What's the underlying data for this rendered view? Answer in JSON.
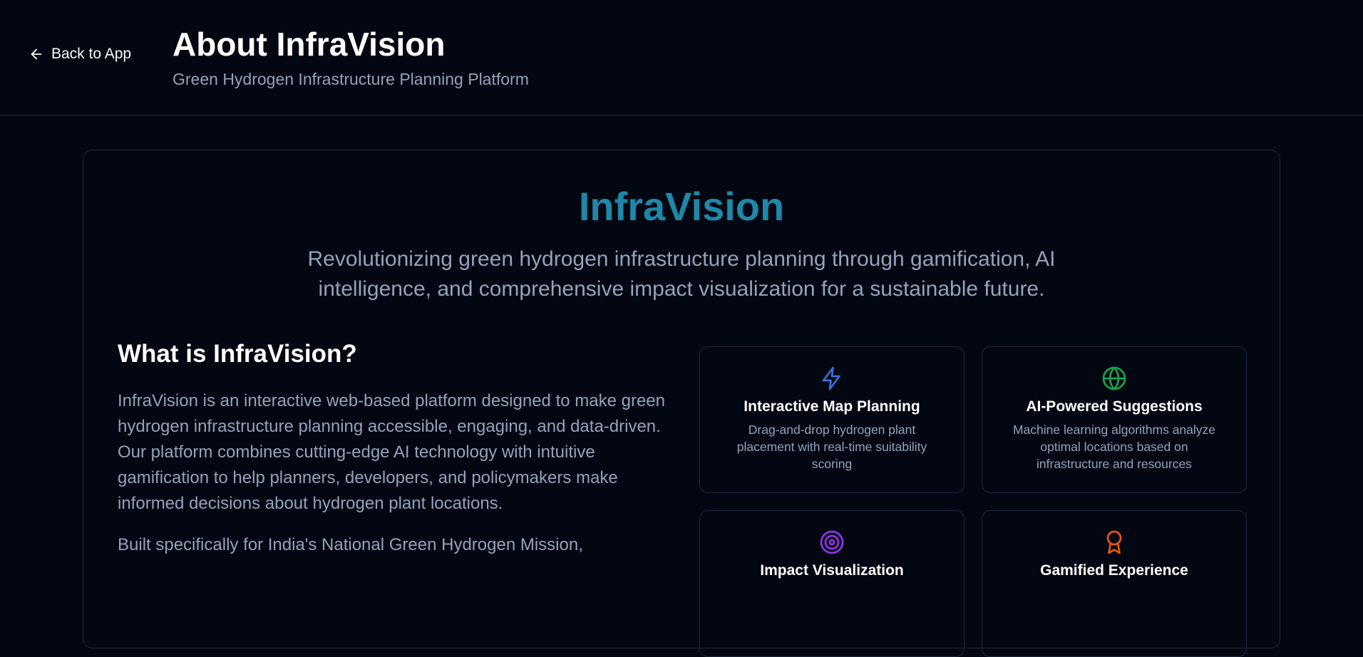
{
  "header": {
    "back_label": "Back to App",
    "title": "About InfraVision",
    "subtitle": "Green Hydrogen Infrastructure Planning Platform"
  },
  "hero": {
    "title": "InfraVision",
    "description": "Revolutionizing green hydrogen infrastructure planning through gamification, AI intelligence, and comprehensive impact visualization for a sustainable future."
  },
  "about": {
    "heading": "What is InfraVision?",
    "paragraphs": [
      "InfraVision is an interactive web-based platform designed to make green hydrogen infrastructure planning accessible, engaging, and data-driven. Our platform combines cutting-edge AI technology with intuitive gamification to help planners, developers, and policymakers make informed decisions about hydrogen plant locations.",
      "Built specifically for India's National Green Hydrogen Mission,"
    ]
  },
  "features": [
    {
      "icon": "zap-icon",
      "color": "#3b6fd9",
      "title": "Interactive Map Planning",
      "description": "Drag-and-drop hydrogen plant placement with real-time suitability scoring"
    },
    {
      "icon": "globe-icon",
      "color": "#16a34a",
      "title": "AI-Powered Suggestions",
      "description": "Machine learning algorithms analyze optimal locations based on infrastructure and resources"
    },
    {
      "icon": "target-icon",
      "color": "#9333ea",
      "title": "Impact Visualization",
      "description": ""
    },
    {
      "icon": "award-icon",
      "color": "#ea580c",
      "title": "Gamified Experience",
      "description": ""
    }
  ]
}
